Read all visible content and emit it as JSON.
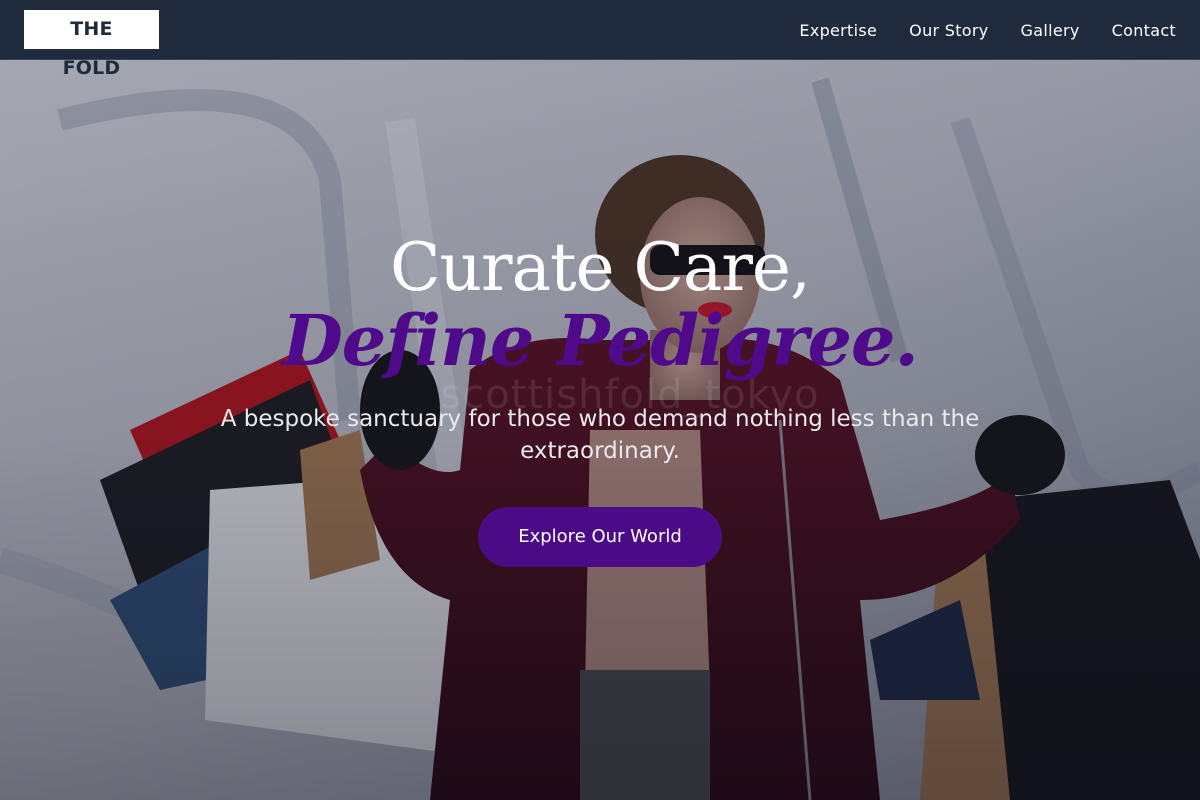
{
  "brand": {
    "logo_text": "THE FOLD"
  },
  "nav": {
    "items": [
      {
        "label": "Expertise"
      },
      {
        "label": "Our Story"
      },
      {
        "label": "Gallery"
      },
      {
        "label": "Contact"
      }
    ]
  },
  "hero": {
    "headline_line1": "Curate Care,",
    "headline_line2": "Define Pedigree.",
    "subtitle": "A bespoke sanctuary for those who demand nothing less than the extraordinary.",
    "cta_label": "Explore Our World",
    "watermark": "scottishfold_tokyo",
    "image_subject": "woman-with-shopping-bags"
  },
  "colors": {
    "nav_background": "#1f2a3c",
    "logo_background": "#ffffff",
    "accent_purple": "#4b0a86",
    "headline_white": "#ffffff"
  }
}
